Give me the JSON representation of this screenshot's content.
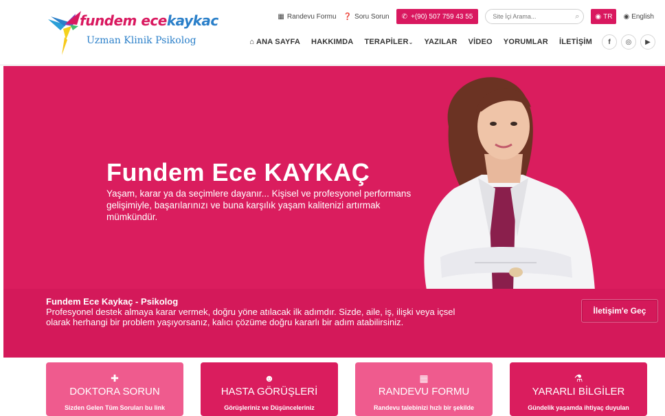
{
  "logo": {
    "title_main": "fundem ece",
    "title_accent": "kaykac",
    "subtitle": "Uzman Klinik Psikolog"
  },
  "topbar": {
    "appointment": "Randevu Formu",
    "ask": "Soru Sorun",
    "phone": "+(90) 507 759 43 55",
    "search_placeholder": "Site İçi Arama...",
    "lang_tr": "TR",
    "lang_en": "English"
  },
  "nav": {
    "home": "ANA SAYFA",
    "about": "HAKKIMDA",
    "therapies": "TERAPİLER",
    "posts": "YAZILAR",
    "video": "VİDEO",
    "comments": "YORUMLAR",
    "contact": "İLETİŞİM"
  },
  "socials": [
    "f",
    "instagram-icon",
    "youtube-icon"
  ],
  "hero": {
    "name": "Fundem Ece KAYKAÇ",
    "text": "Yaşam, karar ya da seçimlere dayanır... Kişisel ve profesyonel performans gelişimiyle, başarılarınızı ve buna karşılık yaşam kalitenizi artırmak mümkündür."
  },
  "band": {
    "title": "Fundem Ece Kaykaç - Psikolog",
    "text": "Profesyonel destek almaya karar vermek, doğru yöne atılacak ilk adımdır. Sizde, aile, iş, ilişki veya içsel olarak herhangi bir problem yaşıyorsanız, kalıcı çözüme doğru kararlı bir adım atabilirsiniz.",
    "button": "İletişim'e Geç"
  },
  "cards": [
    {
      "title": "DOKTORA SORUN",
      "desc": "Sizden Gelen Tüm Soruları bu link"
    },
    {
      "title": "HASTA GÖRÜŞLERİ",
      "desc": "Görüşleriniz ve Düşünceleriniz"
    },
    {
      "title": "RANDEVU FORMU",
      "desc": "Randevu talebinizi hızlı bir şekilde"
    },
    {
      "title": "YARARLI BİLGİLER",
      "desc": "Gündelik yaşamda ihtiyaç duyulan"
    }
  ],
  "colors": {
    "brand_pink": "#da1d5e",
    "light_pink": "#ef5b8e",
    "logo_blue": "#2a7fc9"
  }
}
